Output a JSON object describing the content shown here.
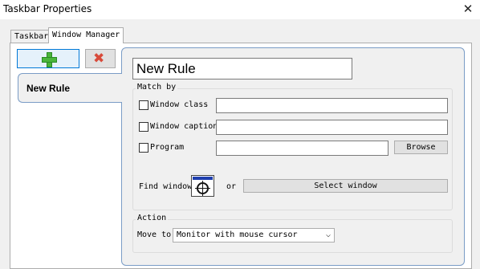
{
  "window": {
    "title": "Taskbar Properties"
  },
  "tabs": [
    {
      "label": "Taskbar"
    },
    {
      "label": "Window Manager"
    }
  ],
  "rules": {
    "items": [
      {
        "label": "New Rule"
      }
    ]
  },
  "rule_editor": {
    "name_value": "New Rule",
    "match_by": {
      "legend": "Match by",
      "window_class_label": "Window class",
      "window_caption_label": "Window caption",
      "program_label": "Program",
      "browse_label": "Browse",
      "find_window_label": "Find window",
      "or_label": "or",
      "select_window_label": "Select window"
    },
    "action": {
      "legend": "Action",
      "move_to_label": "Move to",
      "move_to_value": "Monitor with mouse cursor"
    }
  },
  "icons": {
    "add": "plus-icon",
    "delete": "red-x-icon",
    "finder": "crosshair-finder-icon",
    "close": "close-icon"
  },
  "colors": {
    "accent": "#0078d7",
    "add_green": "#4ab53b",
    "delete_red": "#d84a3a",
    "rule_border": "#7a9cc6"
  }
}
